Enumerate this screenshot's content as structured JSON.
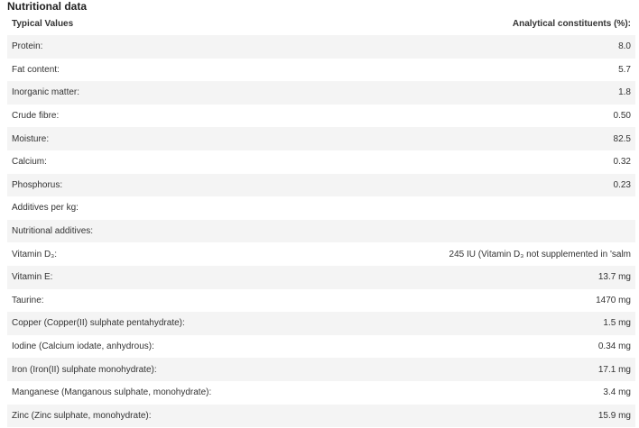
{
  "title": "Nutritional data",
  "columns": {
    "left": "Typical Values",
    "right": "Analytical constituents (%):"
  },
  "rows": [
    {
      "label": "Protein:",
      "value": "8.0"
    },
    {
      "label": "Fat content:",
      "value": "5.7"
    },
    {
      "label": "Inorganic matter:",
      "value": "1.8"
    },
    {
      "label": "Crude fibre:",
      "value": "0.50"
    },
    {
      "label": "Moisture:",
      "value": "82.5"
    },
    {
      "label": "Calcium:",
      "value": "0.32"
    },
    {
      "label": "Phosphorus:",
      "value": "0.23"
    },
    {
      "label": "Additives per kg:",
      "value": ""
    },
    {
      "label": "Nutritional additives:",
      "value": ""
    },
    {
      "label": "Vitamin D₃:",
      "value": "245 IU (Vitamin D₃ not supplemented in 'salm"
    },
    {
      "label": "Vitamin E:",
      "value": "13.7 mg"
    },
    {
      "label": "Taurine:",
      "value": "1470 mg"
    },
    {
      "label": "Copper (Copper(II) sulphate pentahydrate):",
      "value": "1.5 mg"
    },
    {
      "label": "Iodine (Calcium iodate, anhydrous):",
      "value": "0.34 mg"
    },
    {
      "label": "Iron (Iron(II) sulphate monohydrate):",
      "value": "17.1 mg"
    },
    {
      "label": "Manganese (Manganous sulphate, monohydrate):",
      "value": "3.4 mg"
    },
    {
      "label": "Zinc (Zinc sulphate, monohydrate):",
      "value": "15.9 mg"
    }
  ]
}
